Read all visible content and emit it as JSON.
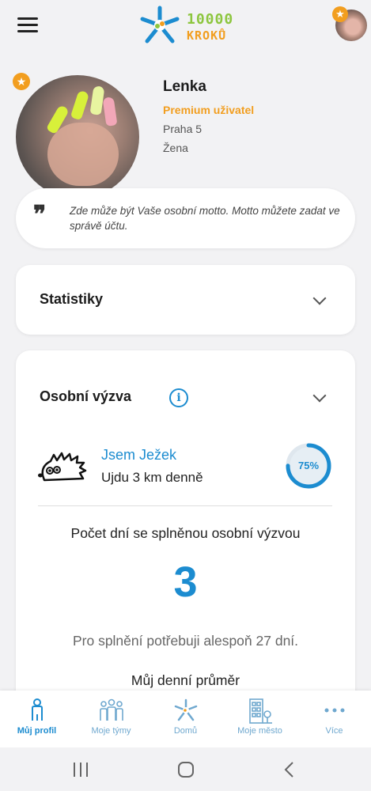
{
  "header": {
    "logo_number": "10000",
    "logo_word": "KROKŮ",
    "icons": [
      "menu-icon",
      "logo-icon",
      "avatar",
      "star-icon"
    ]
  },
  "profile": {
    "name": "Lenka",
    "status": "Premium uživatel",
    "city": "Praha 5",
    "gender": "Žena",
    "motto": "Zde může být Vaše osobní motto. Motto můžete zadat ve správě účtu."
  },
  "statistics": {
    "title": "Statistiky"
  },
  "challenge": {
    "title": "Osobní výzva",
    "name": "Jsem Ježek",
    "description": "Ujdu 3 km denně",
    "progress_percent": 75,
    "progress_label": "75%",
    "days_label": "Počet dní se splněnou osobní výzvou",
    "days_count": "3",
    "requirement": "Pro splnění potřebuji alespoň 27 dní.",
    "average_label": "Můj denní průměr"
  },
  "bottom_nav": {
    "items": [
      {
        "label": "Můj profil",
        "icon": "person-icon",
        "active": true
      },
      {
        "label": "Moje týmy",
        "icon": "team-icon",
        "active": false
      },
      {
        "label": "Domů",
        "icon": "home-logo-icon",
        "active": false
      },
      {
        "label": "Moje město",
        "icon": "city-icon",
        "active": false
      },
      {
        "label": "Více",
        "icon": "more-icon",
        "active": false
      }
    ]
  },
  "colors": {
    "accent": "#1c8cd0",
    "premium": "#f29e1f",
    "logo_green": "#8dc63f",
    "background": "#f2f2f4"
  }
}
